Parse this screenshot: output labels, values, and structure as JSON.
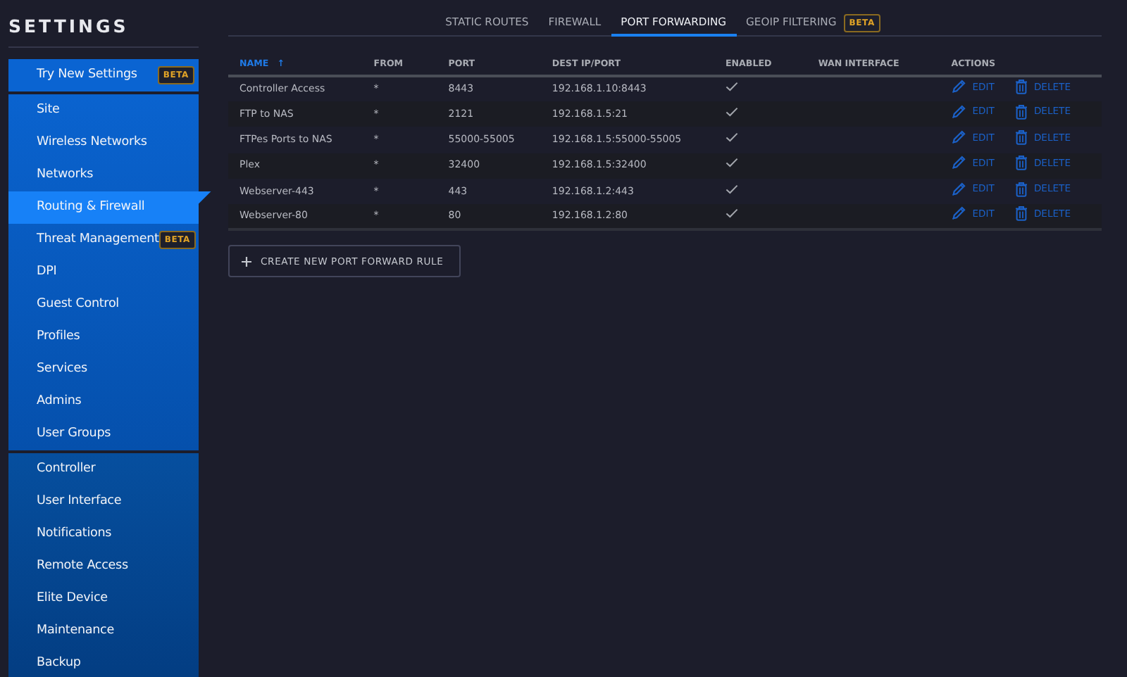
{
  "sidebar": {
    "title": "SETTINGS",
    "groups": [
      {
        "items": [
          {
            "label": "Try New Settings",
            "badge": "BETA",
            "selected": false
          }
        ]
      },
      {
        "items": [
          {
            "label": "Site",
            "selected": false
          },
          {
            "label": "Wireless Networks",
            "selected": false
          },
          {
            "label": "Networks",
            "selected": false
          },
          {
            "label": "Routing & Firewall",
            "selected": true
          },
          {
            "label": "Threat Management",
            "badge": "BETA",
            "selected": false
          },
          {
            "label": "DPI",
            "selected": false
          },
          {
            "label": "Guest Control",
            "selected": false
          },
          {
            "label": "Profiles",
            "selected": false
          },
          {
            "label": "Services",
            "selected": false
          },
          {
            "label": "Admins",
            "selected": false
          },
          {
            "label": "User Groups",
            "selected": false
          }
        ]
      },
      {
        "items": [
          {
            "label": "Controller",
            "selected": false
          },
          {
            "label": "User Interface",
            "selected": false
          },
          {
            "label": "Notifications",
            "selected": false
          },
          {
            "label": "Remote Access",
            "selected": false
          },
          {
            "label": "Elite Device",
            "selected": false
          },
          {
            "label": "Maintenance",
            "selected": false
          },
          {
            "label": "Backup",
            "selected": false
          }
        ]
      }
    ]
  },
  "tabs": [
    {
      "label": "STATIC ROUTES",
      "selected": false
    },
    {
      "label": "FIREWALL",
      "selected": false
    },
    {
      "label": "PORT FORWARDING",
      "selected": true
    },
    {
      "label": "GEOIP FILTERING",
      "badge": "BETA",
      "selected": false
    }
  ],
  "table": {
    "columns": [
      {
        "label": "NAME",
        "sorted": true,
        "sort_arrow": "↑"
      },
      {
        "label": "FROM",
        "sorted": false
      },
      {
        "label": "PORT",
        "sorted": false
      },
      {
        "label": "DEST IP/PORT",
        "sorted": false
      },
      {
        "label": "ENABLED",
        "sorted": false
      },
      {
        "label": "WAN INTERFACE",
        "sorted": false
      },
      {
        "label": "ACTIONS",
        "sorted": false
      }
    ],
    "rows": [
      {
        "name": "Controller Access",
        "from": "*",
        "port": "8443",
        "dest": "192.168.1.10:8443",
        "enabled": true,
        "edit": "EDIT",
        "delete": "DELETE"
      },
      {
        "name": "FTP to NAS",
        "from": "*",
        "port": "2121",
        "dest": "192.168.1.5:21",
        "enabled": true,
        "edit": "EDIT",
        "delete": "DELETE"
      },
      {
        "name": "FTPes Ports to NAS",
        "from": "*",
        "port": "55000-55005",
        "dest": "192.168.1.5:55000-55005",
        "enabled": true,
        "edit": "EDIT",
        "delete": "DELETE"
      },
      {
        "name": "Plex",
        "from": "*",
        "port": "32400",
        "dest": "192.168.1.5:32400",
        "enabled": true,
        "edit": "EDIT",
        "delete": "DELETE"
      },
      {
        "name": "Webserver-443",
        "from": "*",
        "port": "443",
        "dest": "192.168.1.2:443",
        "enabled": true,
        "edit": "EDIT",
        "delete": "DELETE"
      },
      {
        "name": "Webserver-80",
        "from": "*",
        "port": "80",
        "dest": "192.168.1.2:80",
        "enabled": true,
        "edit": "EDIT",
        "delete": "DELETE"
      }
    ]
  },
  "create_button": {
    "label": "CREATE NEW PORT FORWARD RULE"
  }
}
